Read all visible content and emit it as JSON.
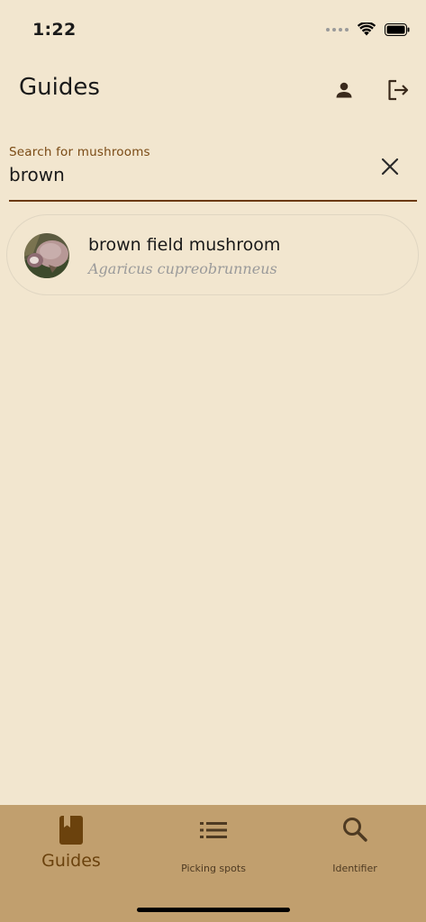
{
  "status_bar": {
    "time": "1:22"
  },
  "app_bar": {
    "title": "Guides",
    "profile_icon": "person-icon",
    "logout_icon": "logout-icon"
  },
  "search": {
    "label": "Search for mushrooms",
    "value": "brown",
    "clear_icon": "close-icon"
  },
  "results": [
    {
      "name": "brown field mushroom",
      "latin_name": "Agaricus cupreobrunneus",
      "thumbnail": "mushroom-photo"
    }
  ],
  "bottom_nav": {
    "items": [
      {
        "label": "Guides",
        "icon": "book-icon",
        "active": true
      },
      {
        "label": "Picking spots",
        "icon": "list-icon",
        "active": false
      },
      {
        "label": "Identifier",
        "icon": "search-icon",
        "active": false
      }
    ]
  },
  "colors": {
    "background": "#f2e6cf",
    "accent": "#6b3a10",
    "nav_background": "#c19f6e",
    "active_nav": "#6b420d",
    "inactive_nav": "#4e3a22",
    "subtitle": "#9a9a9a"
  }
}
